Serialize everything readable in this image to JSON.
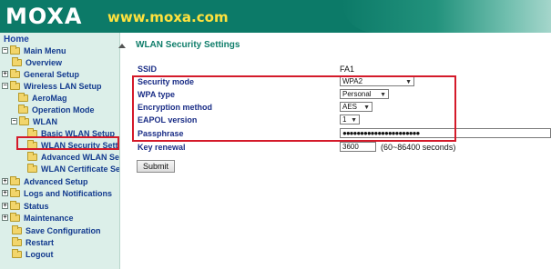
{
  "header": {
    "logo": "MOXA",
    "site": "www.moxa.com"
  },
  "sidebar": {
    "home": "Home",
    "items": [
      {
        "label": "Main Menu",
        "pm": "−"
      },
      {
        "label": "Overview",
        "pm": ""
      },
      {
        "label": "General Setup",
        "pm": "+"
      },
      {
        "label": "Wireless LAN Setup",
        "pm": "−"
      },
      {
        "label": "AeroMag",
        "pm": ""
      },
      {
        "label": "Operation Mode",
        "pm": ""
      },
      {
        "label": "WLAN",
        "pm": "−"
      },
      {
        "label": "Basic WLAN Setup",
        "pm": ""
      },
      {
        "label": "WLAN Security Settings",
        "pm": ""
      },
      {
        "label": "Advanced WLAN Settings",
        "pm": ""
      },
      {
        "label": "WLAN Certificate Settings",
        "pm": ""
      },
      {
        "label": "Advanced Setup",
        "pm": "+"
      },
      {
        "label": "Logs and Notifications",
        "pm": "+"
      },
      {
        "label": "Status",
        "pm": "+"
      },
      {
        "label": "Maintenance",
        "pm": "+"
      },
      {
        "label": "Save Configuration",
        "pm": ""
      },
      {
        "label": "Restart",
        "pm": ""
      },
      {
        "label": "Logout",
        "pm": ""
      }
    ]
  },
  "main": {
    "title": "WLAN Security Settings",
    "ssid_label": "SSID",
    "ssid_value": "FA1",
    "security_mode_label": "Security mode",
    "security_mode_value": "WPA2",
    "wpa_type_label": "WPA type",
    "wpa_type_value": "Personal",
    "encryption_label": "Encryption method",
    "encryption_value": "AES",
    "eapol_label": "EAPOL version",
    "eapol_value": "1",
    "passphrase_label": "Passphrase",
    "passphrase_value": "●●●●●●●●●●●●●●●●●●●●●●",
    "key_renewal_label": "Key renewal",
    "key_renewal_value": "3600",
    "key_renewal_hint": "(60~86400 seconds)",
    "submit_label": "Submit"
  }
}
